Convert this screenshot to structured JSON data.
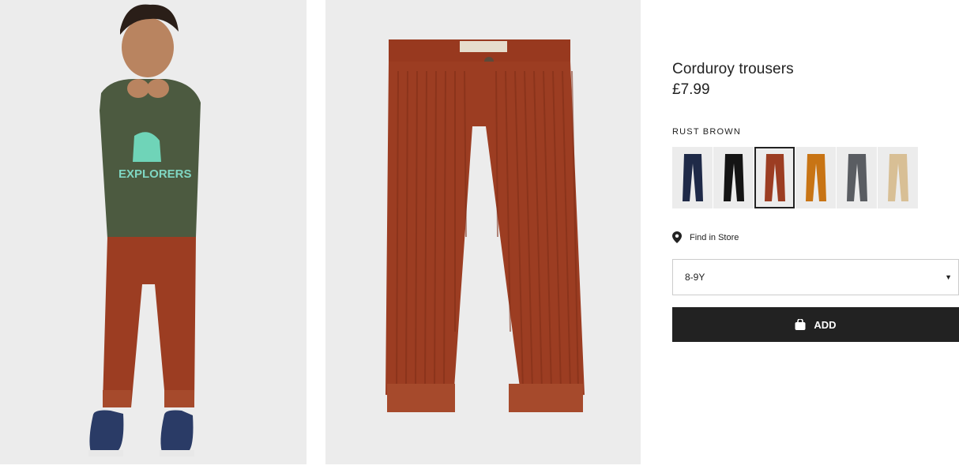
{
  "product": {
    "title": "Corduroy trousers",
    "price": "£7.99",
    "color_name": "RUST BROWN",
    "selected_color_index": 2
  },
  "swatches": [
    {
      "color": "#1f2a48",
      "name": "navy"
    },
    {
      "color": "#141414",
      "name": "black"
    },
    {
      "color": "#9c3d22",
      "name": "rust brown"
    },
    {
      "color": "#c87414",
      "name": "mustard"
    },
    {
      "color": "#5a5d62",
      "name": "grey"
    },
    {
      "color": "#d8bf95",
      "name": "beige"
    }
  ],
  "store": {
    "label": "Find in Store",
    "icon": "location-pin-icon"
  },
  "size_select": {
    "value": "8-9Y",
    "icon": "caret-down-icon"
  },
  "add_button": {
    "label": "ADD",
    "icon": "shopping-bag-icon"
  },
  "colors": {
    "button_bg": "#222222",
    "image_bg": "#ececec",
    "trousers": "#9c3d22"
  }
}
